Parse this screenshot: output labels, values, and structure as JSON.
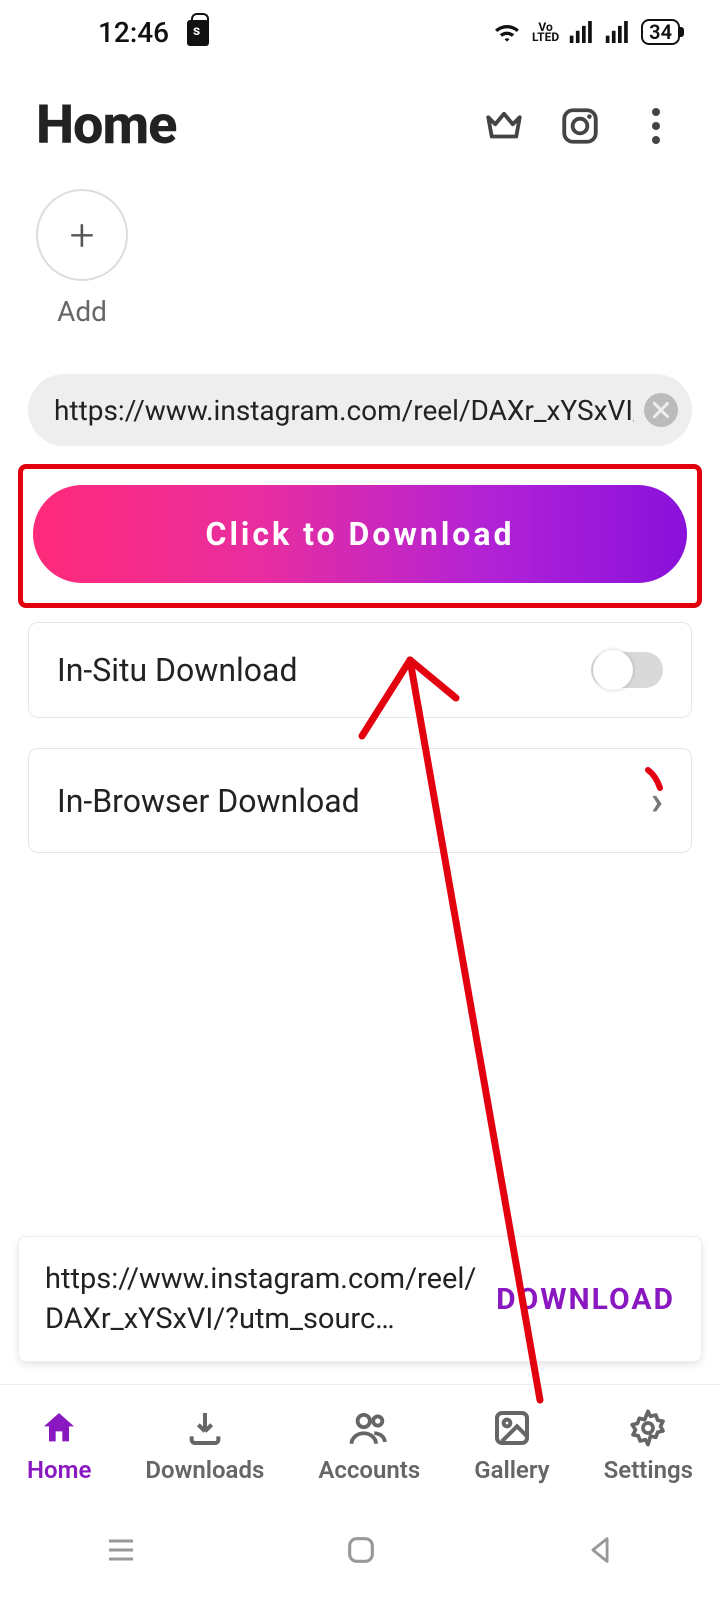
{
  "status": {
    "time": "12:46",
    "battery": "34"
  },
  "header": {
    "title": "Home"
  },
  "stories": {
    "add_label": "Add"
  },
  "url_input": {
    "value": "https://www.instagram.com/reel/DAXr_xYSxVI/?utr"
  },
  "download_button_label": "Click to Download",
  "cards": {
    "insitu_label": "In-Situ Download",
    "browser_label": "In-Browser Download"
  },
  "recent": {
    "url_display": "https://www.instagram.com/reel/DAXr_xYSxVI/?utm_sourc…",
    "action_label": "DOWNLOAD"
  },
  "nav": {
    "home": "Home",
    "downloads": "Downloads",
    "accounts": "Accounts",
    "gallery": "Gallery",
    "settings": "Settings"
  }
}
